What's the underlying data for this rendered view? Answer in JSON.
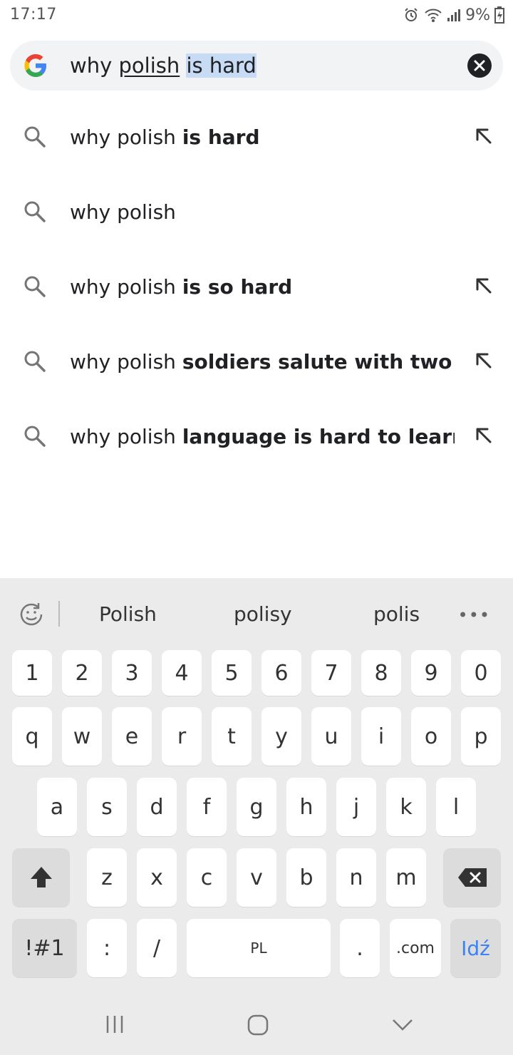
{
  "status": {
    "time": "17:17",
    "battery": "9%"
  },
  "search": {
    "query_part1": "why ",
    "query_part2": "polish",
    "query_part3": " ",
    "query_part4": "is hard"
  },
  "suggestions": [
    {
      "prefix": "why polish ",
      "bold": "is hard",
      "has_arrow": true
    },
    {
      "prefix": "why polish",
      "bold": "",
      "has_arrow": false
    },
    {
      "prefix": "why polish ",
      "bold": "is so hard",
      "has_arrow": true
    },
    {
      "prefix": "why polish ",
      "bold": "soldiers salute with two fi...",
      "has_arrow": true
    },
    {
      "prefix": "why polish ",
      "bold": "language is hard to learn",
      "has_arrow": true
    }
  ],
  "keyboard": {
    "predictions": [
      "Polish",
      "polisy",
      "polis"
    ],
    "more": "•••",
    "row_numbers": [
      "1",
      "2",
      "3",
      "4",
      "5",
      "6",
      "7",
      "8",
      "9",
      "0"
    ],
    "row1": [
      "q",
      "w",
      "e",
      "r",
      "t",
      "y",
      "u",
      "i",
      "o",
      "p"
    ],
    "row2": [
      "a",
      "s",
      "d",
      "f",
      "g",
      "h",
      "j",
      "k",
      "l"
    ],
    "row3": [
      "z",
      "x",
      "c",
      "v",
      "b",
      "n",
      "m"
    ],
    "symbols_label": "!#1",
    "colon_label": ":",
    "slash_label": "/",
    "space_label": "PL",
    "dot_label": ".",
    "dotcom_label": ".com",
    "go_label": "Idź",
    "go_color": "#3b82f6"
  }
}
